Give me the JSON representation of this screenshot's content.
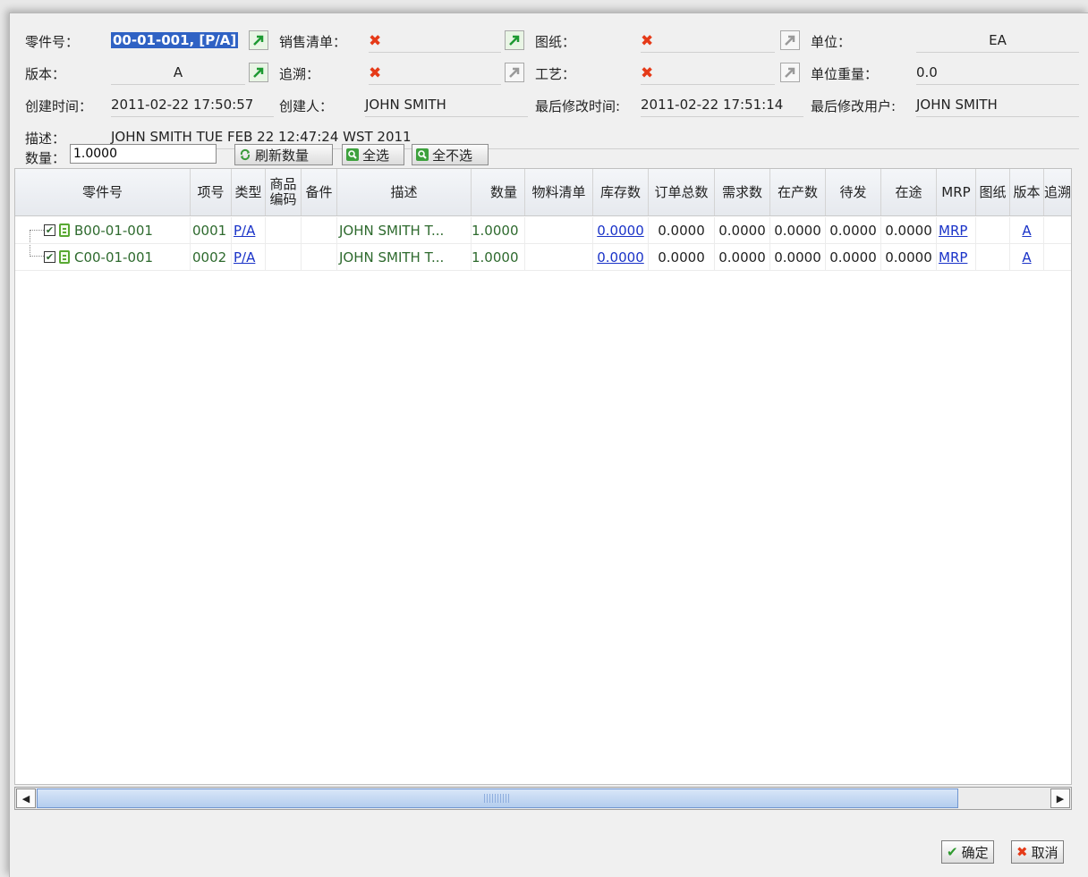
{
  "header": {
    "part_no": {
      "label": "零件号：",
      "value": "00-01-001, [P/A]"
    },
    "sales_list": {
      "label": "销售清单：",
      "value": "✖"
    },
    "drawing": {
      "label": "图纸：",
      "value": "✖"
    },
    "unit": {
      "label": "单位：",
      "value": "EA"
    },
    "version": {
      "label": "版本：",
      "value": "A"
    },
    "trace": {
      "label": "追溯：",
      "value": "✖"
    },
    "process": {
      "label": "工艺：",
      "value": "✖"
    },
    "unit_weight": {
      "label": "单位重量：",
      "value": "0.0"
    },
    "created_time": {
      "label": "创建时间：",
      "value": "2011-02-22 17:50:57"
    },
    "creator": {
      "label": "创建人：",
      "value": "JOHN SMITH"
    },
    "modified_time": {
      "label": "最后修改时间:",
      "value": "2011-02-22 17:51:14"
    },
    "modified_user": {
      "label": "最后修改用户:",
      "value": "JOHN SMITH"
    },
    "description": {
      "label": "描述：",
      "value": "JOHN SMITH TUE FEB 22 12:47:24 WST 2011"
    }
  },
  "toolbar": {
    "qty_label": "数量：",
    "qty_value": "1.0000",
    "refresh_label": "刷新数量",
    "select_all_label": "全选",
    "select_none_label": "全不选"
  },
  "grid": {
    "columns": [
      "零件号",
      "项号",
      "类型",
      "商品编码",
      "备件",
      "描述",
      "数量",
      "物料清单",
      "库存数",
      "订单总数",
      "需求数",
      "在产数",
      "待发",
      "在途",
      "MRP",
      "图纸",
      "版本",
      "追溯"
    ],
    "rows": [
      {
        "part": "B00-01-001",
        "item": "0001",
        "type": "P/A",
        "desc": "JOHN SMITH T...",
        "qty": "1.0000",
        "stock": "0.0000",
        "orders": "0.0000",
        "demand": "0.0000",
        "wip": "0.0000",
        "pending": "0.0000",
        "transit": "0.0000",
        "mrp": "MRP",
        "version": "A"
      },
      {
        "part": "C00-01-001",
        "item": "0002",
        "type": "P/A",
        "desc": "JOHN SMITH T...",
        "qty": "1.0000",
        "stock": "0.0000",
        "orders": "0.0000",
        "demand": "0.0000",
        "wip": "0.0000",
        "pending": "0.0000",
        "transit": "0.0000",
        "mrp": "MRP",
        "version": "A"
      }
    ]
  },
  "footer": {
    "ok_label": "确定",
    "cancel_label": "取消"
  },
  "colors": {
    "accent": "#2f62c4",
    "link": "#1a33c8",
    "cross": "#e53a18",
    "green": "#58a832"
  }
}
